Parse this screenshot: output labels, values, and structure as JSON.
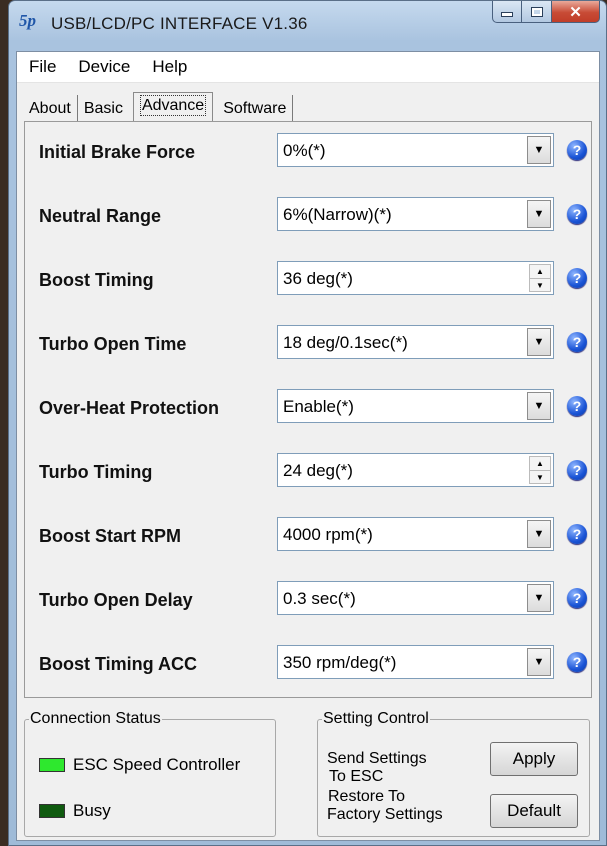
{
  "window": {
    "icon_text": "5p",
    "title": "USB/LCD/PC INTERFACE V1.36",
    "close_glyph": "✕"
  },
  "menu": [
    "File",
    "Device",
    "Help"
  ],
  "tabs": [
    "About",
    "Basic",
    "Advance",
    "Software"
  ],
  "active_tab": "Advance",
  "settings": [
    {
      "label": "Initial Brake Force",
      "value": "0%(*)",
      "control": "dropdown"
    },
    {
      "label": "Neutral Range",
      "value": "6%(Narrow)(*)",
      "control": "dropdown"
    },
    {
      "label": "Boost Timing",
      "value": "36 deg(*)",
      "control": "spinner"
    },
    {
      "label": "Turbo Open Time",
      "value": "18 deg/0.1sec(*)",
      "control": "dropdown"
    },
    {
      "label": "Over-Heat Protection",
      "value": "Enable(*)",
      "control": "dropdown"
    },
    {
      "label": "Turbo Timing",
      "value": "24 deg(*)",
      "control": "spinner"
    },
    {
      "label": "Boost Start RPM",
      "value": "4000 rpm(*)",
      "control": "dropdown"
    },
    {
      "label": "Turbo Open Delay",
      "value": "0.3 sec(*)",
      "control": "dropdown"
    },
    {
      "label": "Boost Timing ACC",
      "value": "350 rpm/deg(*)",
      "control": "dropdown"
    }
  ],
  "help_glyph": "?",
  "connection_status": {
    "title": "Connection Status",
    "esc_label": "ESC Speed Controller",
    "esc_color": "#2ee82e",
    "busy_label": "Busy",
    "busy_color": "#0f5a0f"
  },
  "setting_control": {
    "title": "Setting Control",
    "send_line1": "Send Settings",
    "send_line2": "To ESC",
    "restore_line1": "Restore To",
    "restore_line2": "Factory Settings",
    "apply_label": "Apply",
    "default_label": "Default"
  }
}
